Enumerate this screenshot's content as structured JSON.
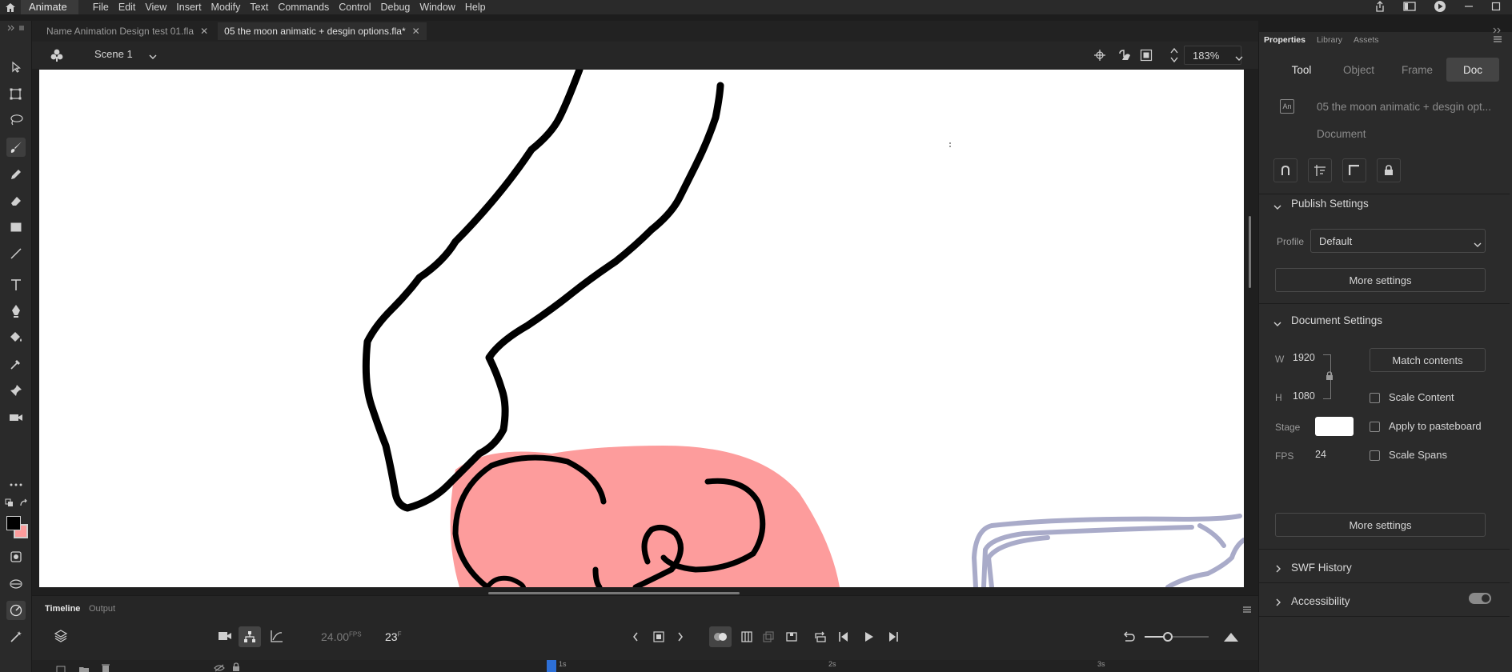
{
  "menubar": {
    "app_name": "Animate",
    "items": [
      "File",
      "Edit",
      "View",
      "Insert",
      "Modify",
      "Text",
      "Commands",
      "Control",
      "Debug",
      "Window",
      "Help"
    ]
  },
  "tabs": [
    {
      "label": "Name Animation Design test 01.fla",
      "active": false
    },
    {
      "label": "05 the moon animatic + desgin options.fla*",
      "active": true
    }
  ],
  "editbar": {
    "scene": "Scene 1",
    "zoom": "183%"
  },
  "properties_panel": {
    "panel_tabs": [
      "Properties",
      "Library",
      "Assets"
    ],
    "sub_tabs": [
      "Tool",
      "Object",
      "Frame",
      "Doc"
    ],
    "active_sub_tab": "Doc",
    "doc_badge": "An",
    "doc_name": "05 the moon animatic + desgin opt...",
    "doc_type": "Document",
    "publish_settings": {
      "title": "Publish Settings",
      "profile_label": "Profile",
      "profile_value": "Default",
      "more_settings": "More settings"
    },
    "document_settings": {
      "title": "Document Settings",
      "w_label": "W",
      "w_value": "1920",
      "h_label": "H",
      "h_value": "1080",
      "match_contents": "Match contents",
      "scale_content": "Scale Content",
      "apply_to_pasteboard": "Apply to pasteboard",
      "scale_spans": "Scale Spans",
      "stage_label": "Stage",
      "stage_color": "#ffffff",
      "fps_label": "FPS",
      "fps_value": "24",
      "more_settings": "More settings"
    },
    "swf_history": "SWF History",
    "accessibility": "Accessibility"
  },
  "timeline": {
    "tabs": [
      "Timeline",
      "Output"
    ],
    "fps": "24.00",
    "fps_unit": "FPS",
    "frame": "23",
    "frame_unit": "F",
    "ruler_marks": [
      "1s",
      "2s",
      "3s"
    ]
  },
  "colors": {
    "accent": "#2d6fd6",
    "fill_pink": "#fd9c9c",
    "stroke_black": "#000000",
    "lavender": "#a9abc9"
  }
}
